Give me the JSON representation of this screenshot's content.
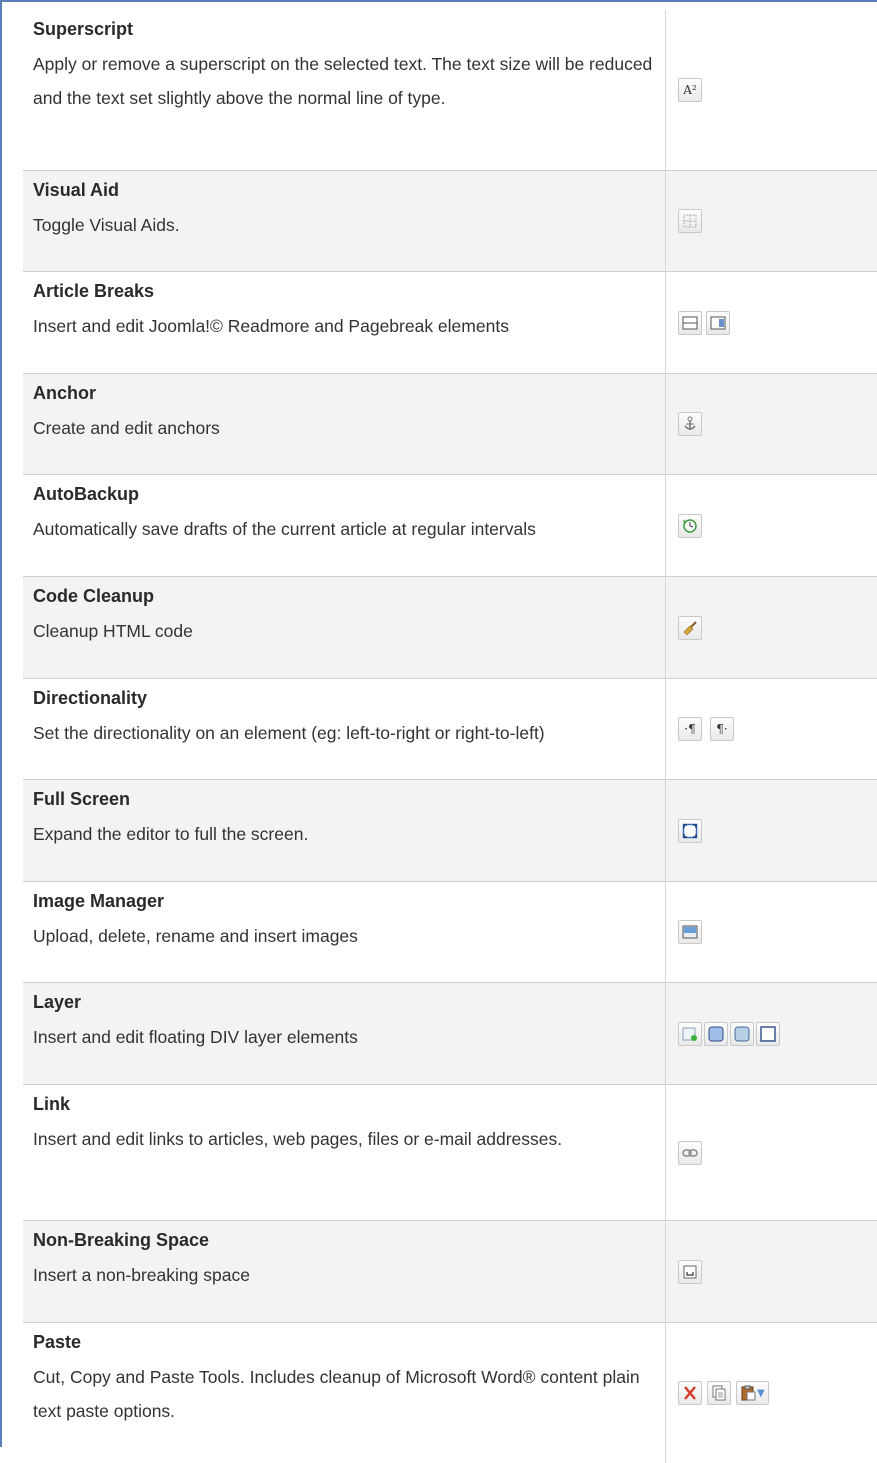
{
  "rows": [
    {
      "title": "Superscript",
      "desc": "Apply or remove a superscript on the selected text. The text size will be reduced and the text set slightly above the normal line of type."
    },
    {
      "title": "Visual Aid",
      "desc": "Toggle Visual Aids."
    },
    {
      "title": "Article Breaks",
      "desc": "Insert and edit Joomla!© Readmore and Pagebreak elements"
    },
    {
      "title": "Anchor",
      "desc": "Create and edit anchors"
    },
    {
      "title": "AutoBackup",
      "desc": "Automatically save drafts of the current article at regular intervals"
    },
    {
      "title": "Code Cleanup",
      "desc": "Cleanup HTML code"
    },
    {
      "title": "Directionality",
      "desc": "Set the directionality on an element (eg: left-to-right or right-to-left)"
    },
    {
      "title": "Full Screen",
      "desc": "Expand the editor to full the screen."
    },
    {
      "title": "Image Manager",
      "desc": "Upload, delete, rename and insert images"
    },
    {
      "title": "Layer",
      "desc": "Insert and edit floating DIV layer elements"
    },
    {
      "title": "Link",
      "desc": "Insert and edit links to articles, web pages, files or e-mail addresses."
    },
    {
      "title": "Non-Breaking Space",
      "desc": "Insert a non-breaking space"
    },
    {
      "title": "Paste",
      "desc": "Cut, Copy and Paste Tools. Includes cleanup of Microsoft Word® content plain text paste options."
    }
  ],
  "icons": {
    "superscript": "superscript-icon",
    "visual_aid": "visual-aid-icon",
    "readmore": "readmore-icon",
    "pagebreak": "pagebreak-icon",
    "anchor": "anchor-icon",
    "autobackup": "autobackup-icon",
    "cleanup": "broom-icon",
    "ltr": "ltr-icon",
    "rtl": "rtl-icon",
    "fullscreen": "fullscreen-icon",
    "image": "image-manager-icon",
    "layer_insert": "insert-layer-icon",
    "layer_forward": "move-forward-icon",
    "layer_backward": "move-backward-icon",
    "layer_absolute": "absolute-layer-icon",
    "link": "link-icon",
    "nbsp": "nbsp-icon",
    "cut": "cut-icon",
    "copy": "copy-icon",
    "paste": "paste-icon"
  },
  "glyphs": {
    "superscript": "A²",
    "ltr": "·¶",
    "rtl": "¶·"
  },
  "colors": {
    "frame_border": "#5b7fb8",
    "row_alt": "#f3f3f3",
    "cut_red": "#d63a2a",
    "paste_brown": "#b06a2a",
    "dropdown_blue": "#5b8fd6"
  }
}
